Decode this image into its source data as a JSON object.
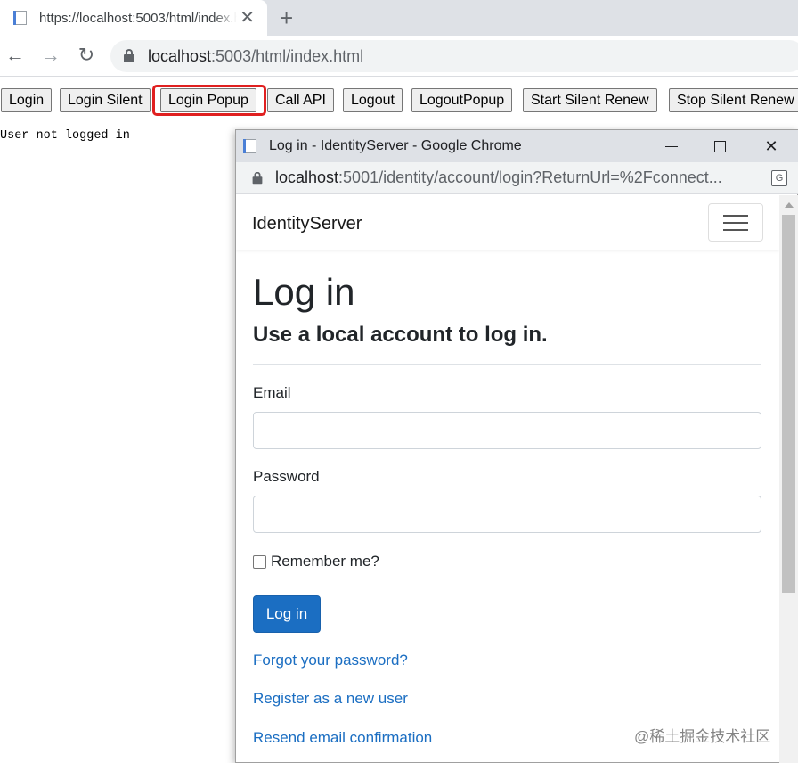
{
  "browser": {
    "tab_title": "https://localhost:5003/html/index.html",
    "new_tab": "+",
    "tab_close": "✕",
    "back": "←",
    "forward": "→",
    "reload": "↻",
    "url_host": "localhost",
    "url_rest": ":5003/html/index.html"
  },
  "page": {
    "buttons": [
      "Login",
      "Login Silent",
      "Login Popup",
      "Call API",
      "Logout",
      "LogoutPopup",
      "Start Silent Renew",
      "Stop Silent Renew"
    ],
    "status": "User not logged in"
  },
  "popup": {
    "window_title": "Log in - IdentityServer - Google Chrome",
    "close": "✕",
    "url_host": "localhost",
    "url_rest": ":5001/identity/account/login?ReturnUrl=%2Fconnect...",
    "translate": "G",
    "brand": "IdentityServer",
    "heading": "Log in",
    "subheading": "Use a local account to log in.",
    "email_label": "Email",
    "password_label": "Password",
    "remember_label": "Remember me?",
    "login_button": "Log in",
    "links": [
      "Forgot your password?",
      "Register as a new user",
      "Resend email confirmation"
    ]
  },
  "watermark": "@稀土掘金技术社区"
}
